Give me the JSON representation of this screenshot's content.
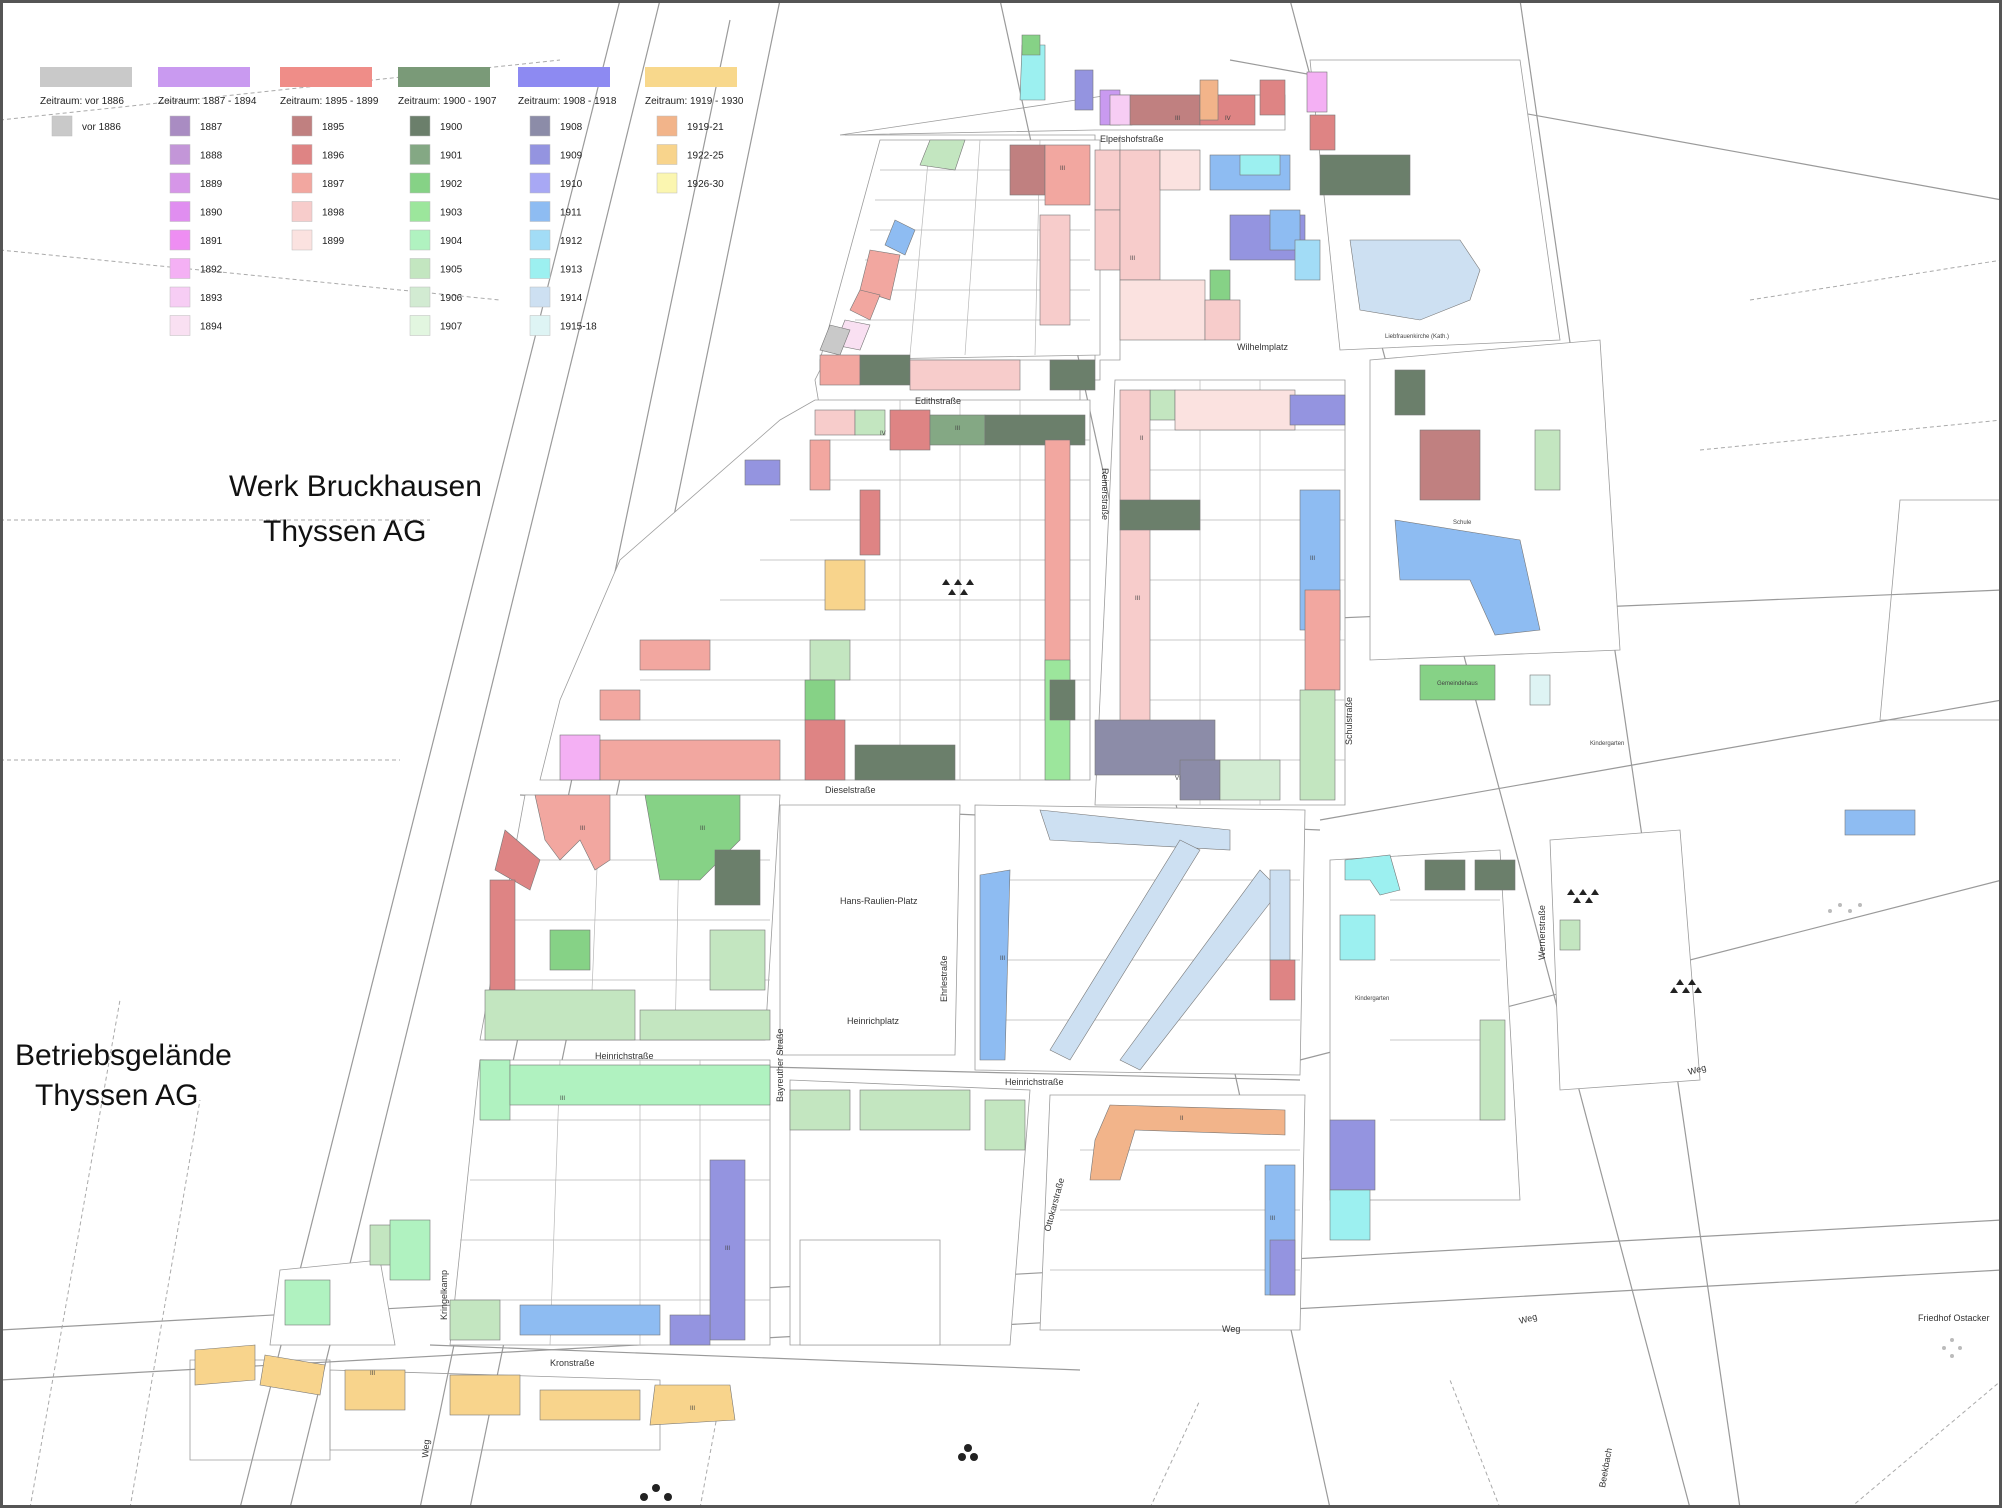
{
  "legend": {
    "groups": [
      {
        "title": "Zeitraum: vor 1886",
        "color": "#c9c9c9",
        "items": [
          {
            "label": "vor 1886",
            "color": "#c9c9c9"
          }
        ]
      },
      {
        "title": "Zeitraum: 1887 - 1894",
        "color": "#c99af0",
        "items": [
          {
            "label": "1887",
            "color": "#a98cc2"
          },
          {
            "label": "1888",
            "color": "#c396d8"
          },
          {
            "label": "1889",
            "color": "#d696e8"
          },
          {
            "label": "1890",
            "color": "#e08ef0"
          },
          {
            "label": "1891",
            "color": "#ee8ef2"
          },
          {
            "label": "1892",
            "color": "#f4b0f4"
          },
          {
            "label": "1893",
            "color": "#f7cdf4"
          },
          {
            "label": "1894",
            "color": "#f9e0f2"
          }
        ]
      },
      {
        "title": "Zeitraum: 1895 - 1899",
        "color": "#ef8d88",
        "items": [
          {
            "label": "1895",
            "color": "#c08080"
          },
          {
            "label": "1896",
            "color": "#de8484"
          },
          {
            "label": "1897",
            "color": "#f2a7a0"
          },
          {
            "label": "1898",
            "color": "#f7cccb"
          },
          {
            "label": "1899",
            "color": "#fbe2e0"
          }
        ]
      },
      {
        "title": "Zeitraum: 1900 - 1907",
        "color": "#7a9a78",
        "items": [
          {
            "label": "1900",
            "color": "#6b7f6b"
          },
          {
            "label": "1901",
            "color": "#84a884"
          },
          {
            "label": "1902",
            "color": "#86d286"
          },
          {
            "label": "1903",
            "color": "#9ce69c"
          },
          {
            "label": "1904",
            "color": "#b0f2c0"
          },
          {
            "label": "1905",
            "color": "#c3e6c0"
          },
          {
            "label": "1906",
            "color": "#d2ebd2"
          },
          {
            "label": "1907",
            "color": "#e2f6e0"
          }
        ]
      },
      {
        "title": "Zeitraum: 1908 - 1918",
        "color": "#8d8af2",
        "items": [
          {
            "label": "1908",
            "color": "#8c8ca8"
          },
          {
            "label": "1909",
            "color": "#9494e0"
          },
          {
            "label": "1910",
            "color": "#a8a8f4"
          },
          {
            "label": "1911",
            "color": "#8ebcf2"
          },
          {
            "label": "1912",
            "color": "#a2dcf6"
          },
          {
            "label": "1913",
            "color": "#9cf0f0"
          },
          {
            "label": "1914",
            "color": "#cde0f2"
          },
          {
            "label": "1915-18",
            "color": "#def4f4"
          }
        ]
      },
      {
        "title": "Zeitraum: 1919 - 1930",
        "color": "#f8d88c",
        "items": [
          {
            "label": "1919-21",
            "color": "#f2b48a"
          },
          {
            "label": "1922-25",
            "color": "#f8d48c"
          },
          {
            "label": "1926-30",
            "color": "#fbf6b0"
          }
        ]
      }
    ]
  },
  "areas": {
    "werk": [
      "Werk Bruckhausen",
      "Thyssen AG"
    ],
    "betrieb": [
      "Betriebsgelände",
      "Thyssen AG"
    ]
  },
  "streets": {
    "elpershofstrasse": "Elpershofstraße",
    "wilhelmplatz": "Wilhelmplatz",
    "edithstrasse": "Edithstraße",
    "reinerstrasse": "Reinerstraße",
    "schulstrasse": "Schulstraße",
    "dieselstrasse": "Dieselstraße",
    "hans_raulien_platz": "Hans-Raulien-Platz",
    "heinrichplatz": "Heinrichplatz",
    "heinrichstrasse_west": "Heinrichstraße",
    "heinrichstrasse_east": "Heinrichstraße",
    "bayreuther_strasse": "Bayreuther Straße",
    "ehrlestrasse": "Ehrlestraße",
    "ottokarstrasse": "Ottokarstraße",
    "wernerstrasse": "Wernerstraße",
    "kronstrasse": "Kronstraße",
    "kringelkamp": "Kringelkamp",
    "weg_a": "Weg",
    "weg_b": "Weg",
    "weg_c": "Weg",
    "weg_d": "Weg",
    "beekbach": "Beekbach"
  },
  "poi": {
    "schule": "Schule",
    "kirche": "Liebfrauenkirche (Kath.)",
    "gemeindehaus": "Gemeindehaus",
    "kindergarten_a": "Kindergarten",
    "kindergarten_b": "Kindergarten",
    "friedhof": "Friedhof Ostacker"
  }
}
